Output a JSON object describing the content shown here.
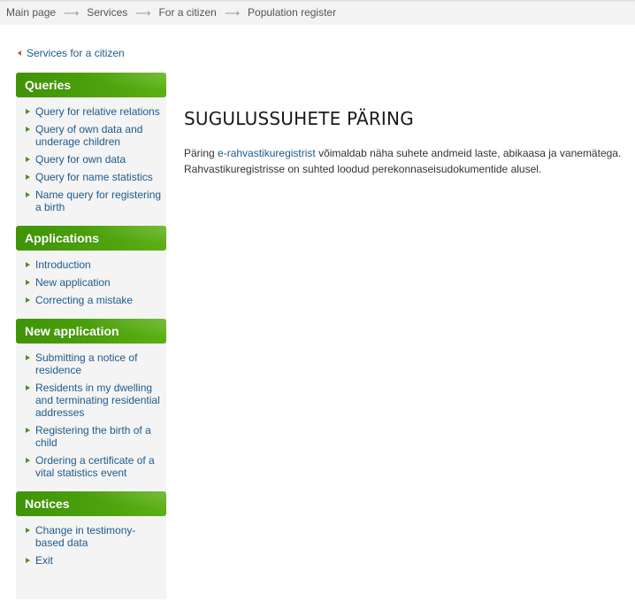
{
  "breadcrumb": {
    "items": [
      "Main page",
      "Services",
      "For a citizen",
      "Population register"
    ],
    "separator": "⟶"
  },
  "back_link": {
    "label": "Services for a citizen",
    "icon": "caret-left-icon",
    "icon_color": "#d0541a"
  },
  "sidebar": {
    "accent_color": "#4ca10c",
    "sections": [
      {
        "title": "Queries",
        "items": [
          "Query for relative relations",
          "Query of own data and underage children",
          "Query for own data",
          "Query for name statistics",
          "Name query for registering a birth"
        ]
      },
      {
        "title": "Applications",
        "items": [
          "Introduction",
          "New application",
          "Correcting a mistake"
        ]
      },
      {
        "title": "New application",
        "items": [
          "Submitting a notice of residence",
          "Residents in my dwelling and terminating residential addresses",
          "Registering the birth of a child",
          "Ordering a certificate of a vital statistics event"
        ]
      },
      {
        "title": "Notices",
        "items": [
          "Change in testimony-based data",
          "Exit"
        ]
      }
    ]
  },
  "content": {
    "title": "SUGULUSSUHETE PÄRING",
    "paragraph": {
      "before_link": "Päring ",
      "link": "e-rahvastikuregistrist",
      "after_link": " võimaldab näha suhete andmeid laste, abikaasa ja vanemätega. Rahvastikuregistrisse on suhted loodud perekonnaseisudokumentide alusel."
    }
  }
}
